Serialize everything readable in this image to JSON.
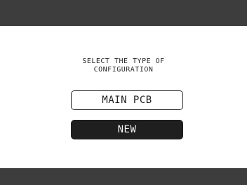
{
  "prompt": {
    "line1": "SELECT THE TYPE OF",
    "line2": "CONFIGURATION"
  },
  "options": [
    {
      "label": "MAIN PCB",
      "selected": false
    },
    {
      "label": "NEW",
      "selected": true
    }
  ],
  "colors": {
    "bar": "#3d3d3d",
    "background": "#ffffff",
    "selected_fill": "#1f1f1f",
    "selected_text": "#f2f2f2",
    "outline": "#2b2b2b"
  }
}
